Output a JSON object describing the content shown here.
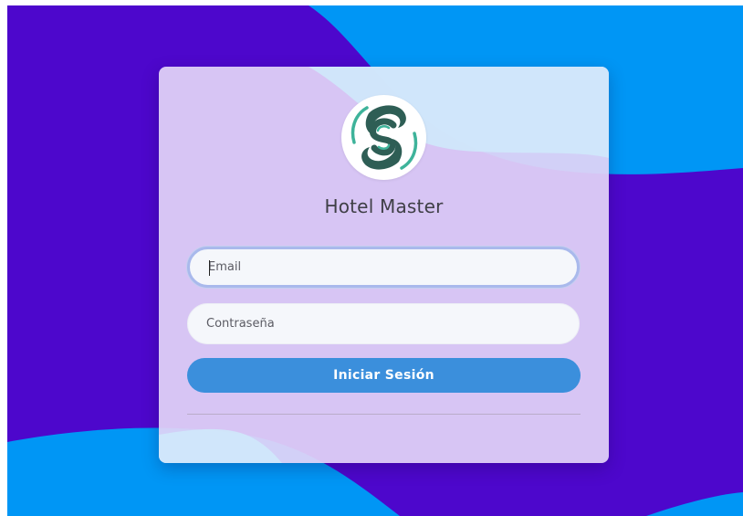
{
  "app": {
    "title": "Hotel Master"
  },
  "logo": {
    "icon": "swirl-s-logo-icon",
    "colors": [
      "#2e5e55",
      "#3eb39a"
    ]
  },
  "form": {
    "email_placeholder": "Email",
    "email_value": "",
    "password_placeholder": "Contraseña",
    "password_value": "",
    "submit_label": "Iniciar Sesión"
  },
  "colors": {
    "background_purple": "#4d07cc",
    "background_blue": "#0095f5",
    "card": "#e2d4f6",
    "button": "#3b8fdc",
    "focus_ring": "#a9b9ec"
  }
}
